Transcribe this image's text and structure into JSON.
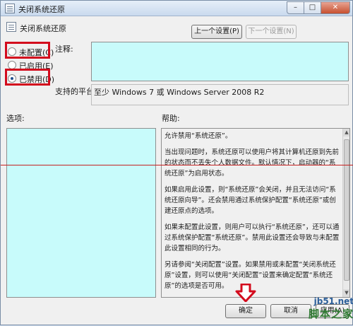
{
  "window": {
    "title": "关闭系统还原",
    "minimize_glyph": "–",
    "maximize_glyph": "□",
    "close_glyph": "✕"
  },
  "header": {
    "title": "关闭系统还原",
    "prev_setting": "上一个设置(P)",
    "next_setting": "下一个设置(N)"
  },
  "radios": [
    {
      "label": "未配置(C)",
      "selected": false
    },
    {
      "label": "已启用(E)",
      "selected": false
    },
    {
      "label": "已禁用(D)",
      "selected": true
    }
  ],
  "comment": {
    "label": "注释:",
    "value": ""
  },
  "platform": {
    "label": "支持的平台:",
    "value": "至少 Windows 7 或 Windows Server 2008 R2"
  },
  "options": {
    "label": "选项:"
  },
  "help": {
    "label": "帮助:",
    "paragraphs": [
      "允许禁用“系统还原”。",
      "当出现问题时，系统还原可以使用户将其计算机还原到先前的状态而不丢失个人数据文件。默认情况下，启动器的“系统还原”为启用状态。",
      "如果启用此设置，则“系统还原”会关闭，并且无法访问“系统还原向导”。还会禁用通过系统保护配置“系统还原”或创建还原点的选项。",
      "如果未配置此设置，则用户可以执行“系统还原”，还可以通过系统保护配置“系统还原”。禁用此设置还会导致与未配置此设置相同的行为。",
      "另请参阅“关闭配置”设置。如果禁用或未配置“关闭系统还原”设置，则可以使用“关闭配置”设置来确定配置“系统还原”的选项是否可用。"
    ]
  },
  "footer": {
    "ok": "确定",
    "cancel": "取消",
    "apply": "应用(A)"
  },
  "watermark": {
    "line1": "jb51.net",
    "line2": "脚本之家"
  },
  "colors": {
    "highlight_red": "#d30b1d",
    "input_cyan": "#c8fbfb"
  }
}
